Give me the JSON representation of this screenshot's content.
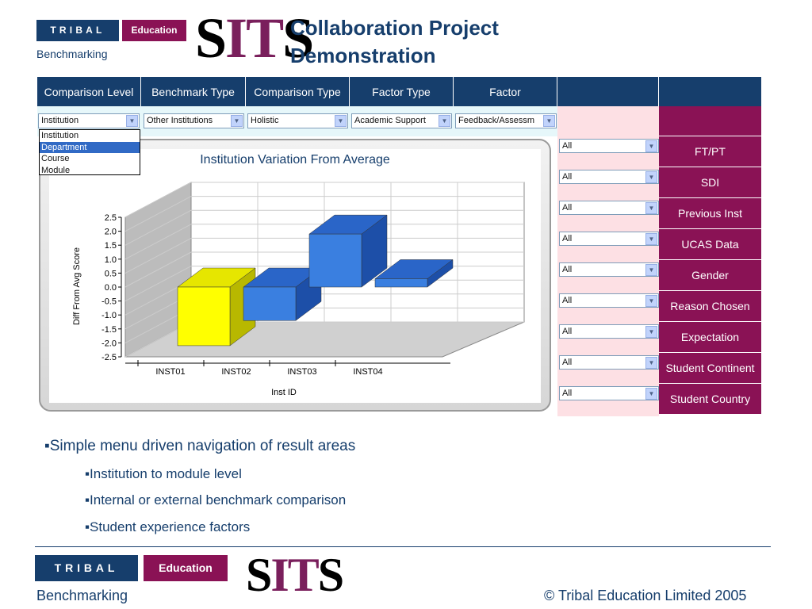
{
  "brand": {
    "tribal": "TRIBAL",
    "education": "Education",
    "benchmarking": "Benchmarking",
    "sits_s1": "S",
    "sits_it": "IT",
    "sits_s2": "S"
  },
  "title": {
    "line1": "Collaboration Project",
    "line2": "Demonstration"
  },
  "headers": [
    "Comparison Level",
    "Benchmark Type",
    "Comparison Type",
    "Factor Type",
    "Factor"
  ],
  "selects": {
    "comparison_level": "Institution",
    "benchmark_type": "Other Institutions",
    "comparison_type": "Holistic",
    "factor_type": "Academic Support",
    "factor": "Feedback/Assessm"
  },
  "dropdown_options": [
    "Institution",
    "Department",
    "Course",
    "Module"
  ],
  "dropdown_highlight": "Department",
  "factors": [
    {
      "label": "FT/PT",
      "value": "All"
    },
    {
      "label": "SDI",
      "value": "All"
    },
    {
      "label": "Previous  Inst",
      "value": "All"
    },
    {
      "label": "UCAS Data",
      "value": "All"
    },
    {
      "label": "Gender",
      "value": "All"
    },
    {
      "label": "Reason Chosen",
      "value": "All"
    },
    {
      "label": "Expectation",
      "value": "All"
    },
    {
      "label": "Student Continent",
      "value": "All"
    },
    {
      "label": "Student Country",
      "value": "All"
    }
  ],
  "chart_data": {
    "type": "bar",
    "title": "Institution Variation From Average",
    "xlabel": "Inst ID",
    "ylabel": "Diff From Avg Score",
    "categories": [
      "INST01",
      "INST02",
      "INST03",
      "INST04"
    ],
    "values": [
      -2.1,
      -1.2,
      1.9,
      0.3
    ],
    "colors": [
      "#ffff00",
      "#3a7fe0",
      "#3a7fe0",
      "#3a7fe0"
    ],
    "ylim": [
      -2.5,
      2.5
    ],
    "yticks": [
      "2.5",
      "2.0",
      "1.5",
      "1.0",
      "0.5",
      "0.0",
      "-0.5",
      "-1.0",
      "-1.5",
      "-2.0",
      "-2.5"
    ],
    "grid": true,
    "style": "3d"
  },
  "bullets": [
    "Simple menu driven navigation of result areas",
    "Institution to module level",
    "Internal or external benchmark comparison",
    "Student experience factors"
  ],
  "footer": {
    "copyright": "© Tribal Education Limited 2005"
  }
}
